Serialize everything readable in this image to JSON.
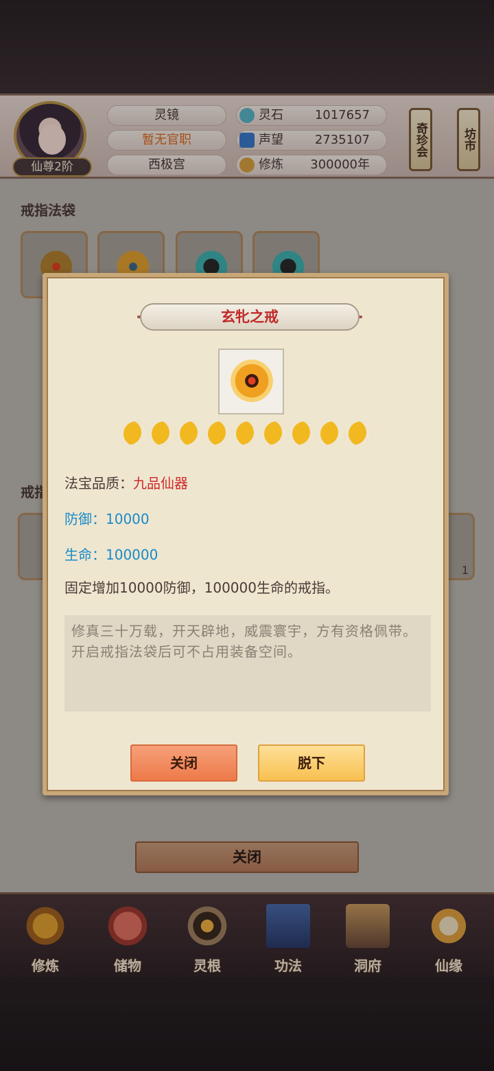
{
  "header": {
    "rank": "仙尊2阶",
    "name": "灵镜",
    "official_title": "暂无官职",
    "palace": "西极宫",
    "resources": [
      {
        "icon": "spirit-stone-icon",
        "label": "灵石",
        "value": "1017657"
      },
      {
        "icon": "prestige-crystal-icon",
        "label": "声望",
        "value": "2735107"
      },
      {
        "icon": "cultivation-icon",
        "label": "修炼",
        "value": "300000年"
      }
    ],
    "side_buttons": [
      "奇珍会",
      "坊市"
    ]
  },
  "main": {
    "ring_bag_title": "戒指法袋",
    "second_section_title_partial": "戒指",
    "close_label": "关闭",
    "count_badge": "1"
  },
  "modal": {
    "title": "玄牝之戒",
    "item_icon": "fire-ring-icon",
    "star_count": 9,
    "quality_label": "法宝品质：",
    "quality_value": "九品仙器",
    "defense_label": "防御：",
    "defense_value": "10000",
    "hp_label": "生命：",
    "hp_value": "100000",
    "description": "固定增加10000防御，100000生命的戒指。",
    "flavor_text": "修真三十万载，开天辟地，威震寰宇，方有资格佩带。开启戒指法袋后可不占用装备空间。",
    "close_button": "关闭",
    "unequip_button": "脱下"
  },
  "bottom_nav": [
    {
      "label": "修炼",
      "icon": "cultivate-icon"
    },
    {
      "label": "储物",
      "icon": "storage-bag-icon"
    },
    {
      "label": "灵根",
      "icon": "spirit-root-icon"
    },
    {
      "label": "功法",
      "icon": "technique-book-icon"
    },
    {
      "label": "洞府",
      "icon": "cave-dwelling-icon"
    },
    {
      "label": "仙缘",
      "icon": "fate-gourd-icon"
    }
  ],
  "colors": {
    "quality_red": "#d02828",
    "stat_blue": "#1a8ac8",
    "title_red": "#c02828"
  }
}
